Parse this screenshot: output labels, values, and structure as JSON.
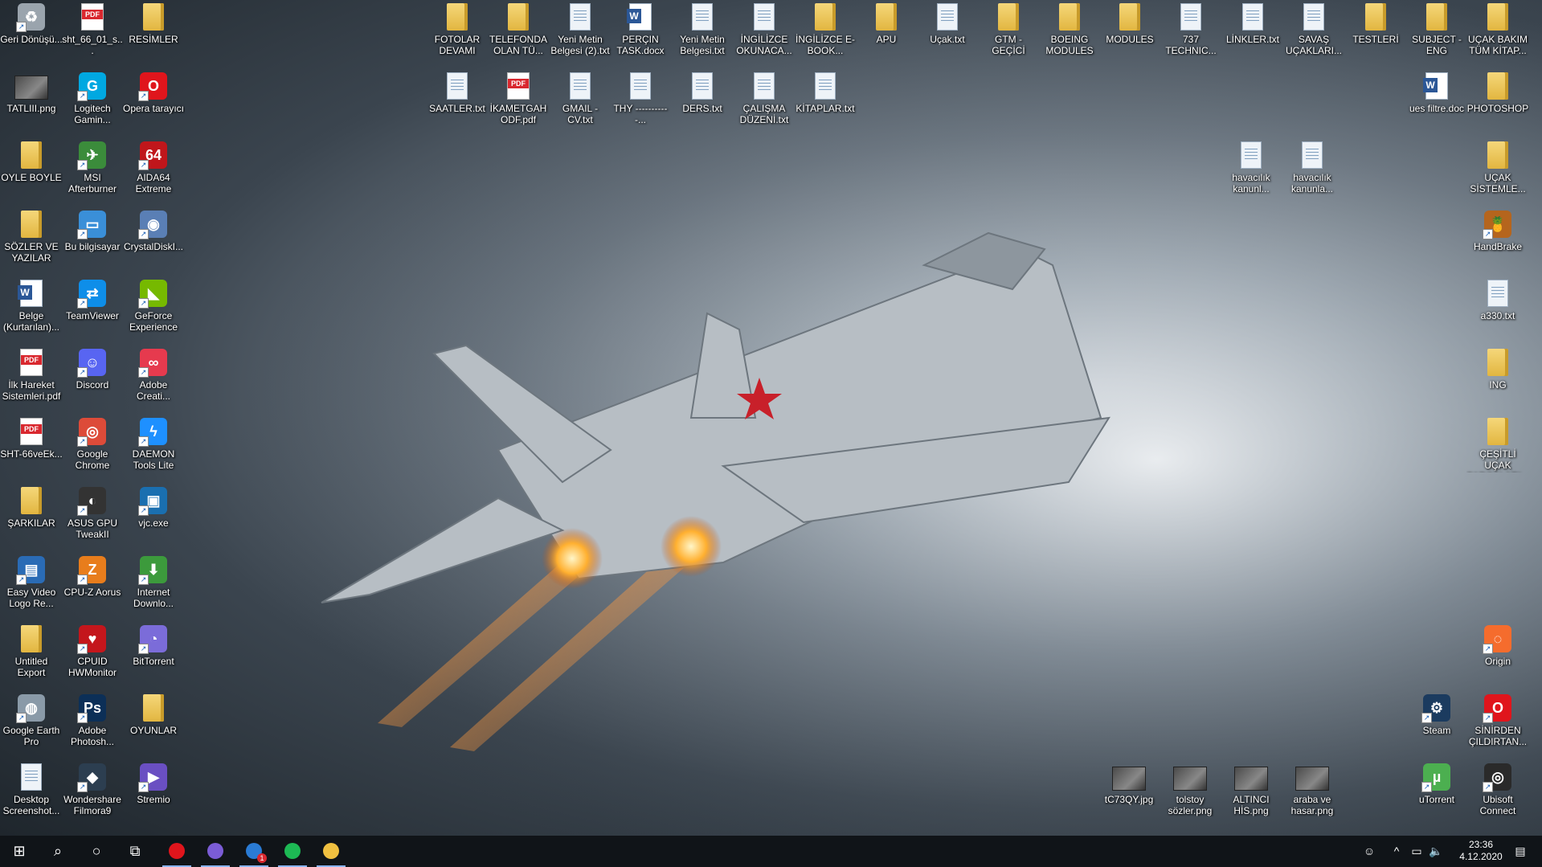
{
  "desktop_icons": [
    {
      "label": "Geri Dönüşü...",
      "icon": "recycle-bin-icon",
      "kind": "app",
      "color": "#9aa4ad",
      "sym": "♻"
    },
    {
      "label": "sht_66_01_s...",
      "icon": "pdf-file-icon",
      "kind": "pdf"
    },
    {
      "label": "RESİMLER",
      "icon": "folder-icon",
      "kind": "folder"
    },
    {
      "label": "TATLIII.png",
      "icon": "image-file-icon",
      "kind": "img"
    },
    {
      "label": "Logitech Gamin...",
      "icon": "logitech-g-icon",
      "kind": "app",
      "color": "#00a8e1",
      "sym": "G"
    },
    {
      "label": "Opera tarayıcı",
      "icon": "opera-icon",
      "kind": "app",
      "color": "#e0151c",
      "sym": "O"
    },
    {
      "label": "OYLE BOYLE",
      "icon": "folder-icon",
      "kind": "folder"
    },
    {
      "label": "MSI Afterburner",
      "icon": "msi-afterburner-icon",
      "kind": "app",
      "color": "#3b8c3b",
      "sym": "✈"
    },
    {
      "label": "AIDA64 Extreme",
      "icon": "aida64-icon",
      "kind": "app",
      "color": "#c0161b",
      "sym": "64"
    },
    {
      "label": "SÖZLER VE YAZILAR",
      "icon": "folder-icon",
      "kind": "folder"
    },
    {
      "label": "Bu bilgisayar",
      "icon": "this-pc-icon",
      "kind": "app",
      "color": "#3a8fd8",
      "sym": "▭"
    },
    {
      "label": "CrystalDiskI...",
      "icon": "crystaldiskinfo-icon",
      "kind": "app",
      "color": "#5a7fb5",
      "sym": "◉"
    },
    {
      "label": "Belge (Kurtarılan)...",
      "icon": "word-document-icon",
      "kind": "word"
    },
    {
      "label": "TeamViewer",
      "icon": "teamviewer-icon",
      "kind": "app",
      "color": "#0e8ee9",
      "sym": "⇄"
    },
    {
      "label": "GeForce Experience",
      "icon": "geforce-icon",
      "kind": "app",
      "color": "#76b900",
      "sym": "◣"
    },
    {
      "label": "İlk Hareket Sistemleri.pdf",
      "icon": "pdf-file-icon",
      "kind": "pdf"
    },
    {
      "label": "Discord",
      "icon": "discord-icon",
      "kind": "app",
      "color": "#5865f2",
      "sym": "☺"
    },
    {
      "label": "Adobe Creati...",
      "icon": "adobe-cc-icon",
      "kind": "app",
      "color": "#e63a4e",
      "sym": "∞"
    },
    {
      "label": "SHT-66veEk...",
      "icon": "pdf-file-icon",
      "kind": "pdf"
    },
    {
      "label": "Google Chrome",
      "icon": "chrome-icon",
      "kind": "app",
      "color": "#dd4b39",
      "sym": "◎"
    },
    {
      "label": "DAEMON Tools Lite",
      "icon": "daemon-tools-icon",
      "kind": "app",
      "color": "#1e90ff",
      "sym": "ϟ"
    },
    {
      "label": "ŞARKILAR",
      "icon": "folder-icon",
      "kind": "folder"
    },
    {
      "label": "ASUS GPU TweakII",
      "icon": "asus-gpu-tweak-icon",
      "kind": "app",
      "color": "#333",
      "sym": "◐"
    },
    {
      "label": "vjc.exe",
      "icon": "vjc-exe-icon",
      "kind": "app",
      "color": "#1a6fb0",
      "sym": "▣"
    },
    {
      "label": "Easy Video Logo Re...",
      "icon": "easy-video-logo-icon",
      "kind": "app",
      "color": "#2a6bb5",
      "sym": "▤"
    },
    {
      "label": "CPU-Z Aorus",
      "icon": "cpuz-icon",
      "kind": "app",
      "color": "#e87d1c",
      "sym": "Z"
    },
    {
      "label": "Internet Downlo...",
      "icon": "idm-icon",
      "kind": "app",
      "color": "#3c9a3c",
      "sym": "⬇"
    },
    {
      "label": "Untitled Export",
      "icon": "folder-icon",
      "kind": "folder"
    },
    {
      "label": "CPUID HWMonitor",
      "icon": "hwmonitor-icon",
      "kind": "app",
      "color": "#c4161c",
      "sym": "♥"
    },
    {
      "label": "BitTorrent",
      "icon": "bittorrent-icon",
      "kind": "app",
      "color": "#7b6cd9",
      "sym": "◔"
    },
    {
      "label": "Google Earth Pro",
      "icon": "google-earth-icon",
      "kind": "app",
      "color": "#8a9aa8",
      "sym": "◍"
    },
    {
      "label": "Adobe Photosh...",
      "icon": "photoshop-icon",
      "kind": "app",
      "color": "#0c2f57",
      "sym": "Ps"
    },
    {
      "label": "OYUNLAR",
      "icon": "folder-icon",
      "kind": "folder"
    },
    {
      "label": "Desktop Screenshot...",
      "icon": "screenshot-icon",
      "kind": "doc"
    },
    {
      "label": "Wondershare Filmora9",
      "icon": "filmora-icon",
      "kind": "app",
      "color": "#2c3e50",
      "sym": "◆"
    },
    {
      "label": "Stremio",
      "icon": "stremio-icon",
      "kind": "app",
      "color": "#6a4fc2",
      "sym": "▶"
    },
    {
      "label": "FOTOLAR DEVAMI",
      "icon": "folder-icon",
      "kind": "folder"
    },
    {
      "label": "TELEFONDA OLAN TÜ...",
      "icon": "folder-icon",
      "kind": "folder"
    },
    {
      "label": "Yeni Metin Belgesi (2).txt",
      "icon": "text-file-icon",
      "kind": "doc"
    },
    {
      "label": "PERÇIN TASK.docx",
      "icon": "word-document-icon",
      "kind": "word"
    },
    {
      "label": "Yeni Metin Belgesi.txt",
      "icon": "text-file-icon",
      "kind": "doc"
    },
    {
      "label": "İNGİLİZCE OKUNACA...",
      "icon": "text-file-icon",
      "kind": "doc"
    },
    {
      "label": "İNGİLİZCE E-BOOK...",
      "icon": "folder-icon",
      "kind": "folder"
    },
    {
      "label": "APU",
      "icon": "folder-icon",
      "kind": "folder"
    },
    {
      "label": "Uçak.txt",
      "icon": "text-file-icon",
      "kind": "doc"
    },
    {
      "label": "GTM - GEÇİCİ",
      "icon": "folder-icon",
      "kind": "folder"
    },
    {
      "label": "BOEING MODULES",
      "icon": "folder-icon",
      "kind": "folder"
    },
    {
      "label": "MODULES",
      "icon": "folder-icon",
      "kind": "folder"
    },
    {
      "label": "737 TECHNIC...",
      "icon": "text-file-icon",
      "kind": "doc"
    },
    {
      "label": "LİNKLER.txt",
      "icon": "text-file-icon",
      "kind": "doc"
    },
    {
      "label": "SAVAŞ UÇAKLARI...",
      "icon": "text-file-icon",
      "kind": "doc"
    },
    {
      "label": "TESTLERİ",
      "icon": "folder-icon",
      "kind": "folder"
    },
    {
      "label": "SUBJECT - ENG",
      "icon": "folder-icon",
      "kind": "folder"
    },
    {
      "label": "UÇAK BAKIM TÜM KİTAP...",
      "icon": "folder-icon",
      "kind": "folder"
    },
    {
      "label": "SAATLER.txt",
      "icon": "text-file-icon",
      "kind": "doc"
    },
    {
      "label": "İKAMETGAH ODF.pdf",
      "icon": "pdf-file-icon",
      "kind": "pdf"
    },
    {
      "label": "GMAIL - CV.txt",
      "icon": "text-file-icon",
      "kind": "doc"
    },
    {
      "label": "THY -----------...",
      "icon": "text-file-icon",
      "kind": "doc"
    },
    {
      "label": "DERS.txt",
      "icon": "text-file-icon",
      "kind": "doc"
    },
    {
      "label": "ÇALIŞMA DÜZENİ.txt",
      "icon": "text-file-icon",
      "kind": "doc"
    },
    {
      "label": "KİTAPLAR.txt",
      "icon": "text-file-icon",
      "kind": "doc"
    },
    {
      "label": "ues filtre.doc",
      "icon": "word-document-icon",
      "kind": "word"
    },
    {
      "label": "PHOTOSHOP",
      "icon": "folder-icon",
      "kind": "folder"
    },
    {
      "label": "havacılık kanunl...",
      "icon": "document-file-icon",
      "kind": "doc"
    },
    {
      "label": "havacılık kanunla...",
      "icon": "document-file-icon",
      "kind": "doc"
    },
    {
      "label": "UÇAK SİSTEMLE...",
      "icon": "folder-icon",
      "kind": "folder"
    },
    {
      "label": "HandBrake",
      "icon": "handbrake-icon",
      "kind": "app",
      "color": "#b5651d",
      "sym": "🍍"
    },
    {
      "label": "a330.txt",
      "icon": "text-file-icon",
      "kind": "doc"
    },
    {
      "label": "ING",
      "icon": "folder-icon",
      "kind": "folder"
    },
    {
      "label": "ÇEŞİTLİ UÇAK PARÇALARI...",
      "icon": "folder-icon",
      "kind": "folder"
    },
    {
      "label": "Origin",
      "icon": "origin-icon",
      "kind": "app",
      "color": "#f56c2d",
      "sym": "◌"
    },
    {
      "label": "Steam",
      "icon": "steam-icon",
      "kind": "app",
      "color": "#1b3b5f",
      "sym": "⚙"
    },
    {
      "label": "SİNİRDEN ÇILDIRTAN...",
      "icon": "opera-gx-icon",
      "kind": "app",
      "color": "#e0151c",
      "sym": "O"
    },
    {
      "label": "tC73QY.jpg",
      "icon": "image-file-icon",
      "kind": "img"
    },
    {
      "label": "tolstoy sözler.png",
      "icon": "image-file-icon",
      "kind": "img"
    },
    {
      "label": "ALTINCI HİS.png",
      "icon": "image-file-icon",
      "kind": "img"
    },
    {
      "label": "araba ve hasar.png",
      "icon": "image-file-icon",
      "kind": "img"
    },
    {
      "label": "uTorrent",
      "icon": "utorrent-icon",
      "kind": "app",
      "color": "#4caf50",
      "sym": "µ"
    },
    {
      "label": "Ubisoft Connect",
      "icon": "ubisoft-icon",
      "kind": "app",
      "color": "#2a2a2a",
      "sym": "◎"
    }
  ],
  "taskbar": {
    "apps": [
      {
        "name": "opera",
        "icon": "opera-icon",
        "color": "#e0151c"
      },
      {
        "name": "stremio",
        "icon": "stremio-icon",
        "color": "#7b5cd6"
      },
      {
        "name": "store",
        "icon": "store-icon",
        "color": "#2a7bd4",
        "badge": "1"
      },
      {
        "name": "spotify",
        "icon": "spotify-icon",
        "color": "#1db954"
      },
      {
        "name": "file-explorer",
        "icon": "folder-icon",
        "color": "#f0c040"
      }
    ],
    "time": "23:36",
    "date": "4.12.2020"
  }
}
